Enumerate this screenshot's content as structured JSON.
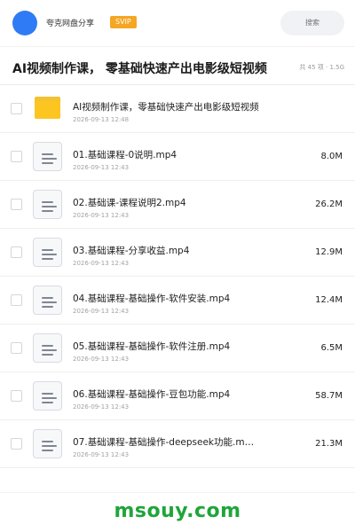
{
  "header": {
    "brand_label": "夸克网盘分享",
    "badge_label": "SVIP",
    "search_placeholder": "搜索"
  },
  "share": {
    "title": "AI视频制作课， 零基础快速产出电影级短视频",
    "summary": "共 45 项 · 1.5G"
  },
  "files": [
    {
      "type": "folder",
      "name": "AI视频制作课，零基础快速产出电影级短视频",
      "date": "2026-09-13 12:48",
      "size": ""
    },
    {
      "type": "file",
      "name": "01.基础课程-0说明.mp4",
      "date": "2026-09-13 12:43",
      "size": "8.0M"
    },
    {
      "type": "file",
      "name": "02.基础课-课程说明2.mp4",
      "date": "2026-09-13 12:43",
      "size": "26.2M"
    },
    {
      "type": "file",
      "name": "03.基础课程-分享收益.mp4",
      "date": "2026-09-13 12:43",
      "size": "12.9M"
    },
    {
      "type": "file",
      "name": "04.基础课程-基础操作-软件安装.mp4",
      "date": "2026-09-13 12:43",
      "size": "12.4M"
    },
    {
      "type": "file",
      "name": "05.基础课程-基础操作-软件注册.mp4",
      "date": "2026-09-13 12:43",
      "size": "6.5M"
    },
    {
      "type": "file",
      "name": "06.基础课程-基础操作-豆包功能.mp4",
      "date": "2026-09-13 12:43",
      "size": "58.7M"
    },
    {
      "type": "file",
      "name": "07.基础课程-基础操作-deepseek功能.m…",
      "date": "2026-09-13 12:43",
      "size": "21.3M"
    }
  ],
  "footer": {
    "watermark": "msouy.com"
  },
  "colors": {
    "accent_blue": "#2f7bf5",
    "svip_orange": "#f5a623",
    "folder_yellow": "#fcc520",
    "watermark_green": "#1fa53a"
  }
}
